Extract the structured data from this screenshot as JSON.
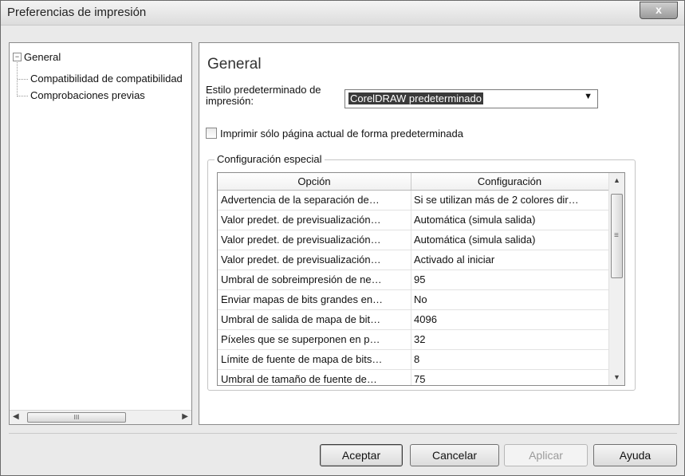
{
  "window": {
    "title": "Preferencias de impresión",
    "close_glyph": "x"
  },
  "tree": {
    "toggle_glyph": "−",
    "items": [
      {
        "label": "General"
      },
      {
        "label": "Compatibilidad de compatibilidad"
      },
      {
        "label": "Comprobaciones previas"
      }
    ],
    "scroll_left": "◀",
    "scroll_right": "▶",
    "scroll_thumb": "III"
  },
  "panel": {
    "title": "General",
    "style_label": "Estilo predeterminado de impresión:",
    "style_value": "CorelDRAW predeterminado",
    "dropdown_arrow": "▼",
    "checkbox_label": "Imprimir sólo página actual de forma predeterminada",
    "checkbox_checked": false,
    "group_label": "Configuración especial"
  },
  "grid": {
    "headers": [
      "Opción",
      "Configuración"
    ],
    "rows": [
      {
        "option": "Advertencia de la separación de…",
        "value": "Si se utilizan más de 2 colores dir…"
      },
      {
        "option": "Valor predet. de previsualización…",
        "value": "Automática (simula salida)"
      },
      {
        "option": "Valor predet. de previsualización…",
        "value": "Automática (simula salida)"
      },
      {
        "option": "Valor predet. de previsualización…",
        "value": "Activado al iniciar"
      },
      {
        "option": "Umbral de sobreimpresión de ne…",
        "value": "95"
      },
      {
        "option": "Enviar mapas de bits grandes en…",
        "value": "No"
      },
      {
        "option": "Umbral de salida de mapa de bit…",
        "value": "4096"
      },
      {
        "option": "Píxeles que se superponen en p…",
        "value": "32"
      },
      {
        "option": "Límite de fuente de mapa de bits…",
        "value": "8"
      },
      {
        "option": "Umbral de tamaño de fuente de…",
        "value": "75"
      }
    ],
    "scroll_up": "▲",
    "scroll_down": "▼",
    "scroll_grip": "≡"
  },
  "buttons": {
    "accept": "Aceptar",
    "cancel": "Cancelar",
    "apply": "Aplicar",
    "help": "Ayuda"
  }
}
